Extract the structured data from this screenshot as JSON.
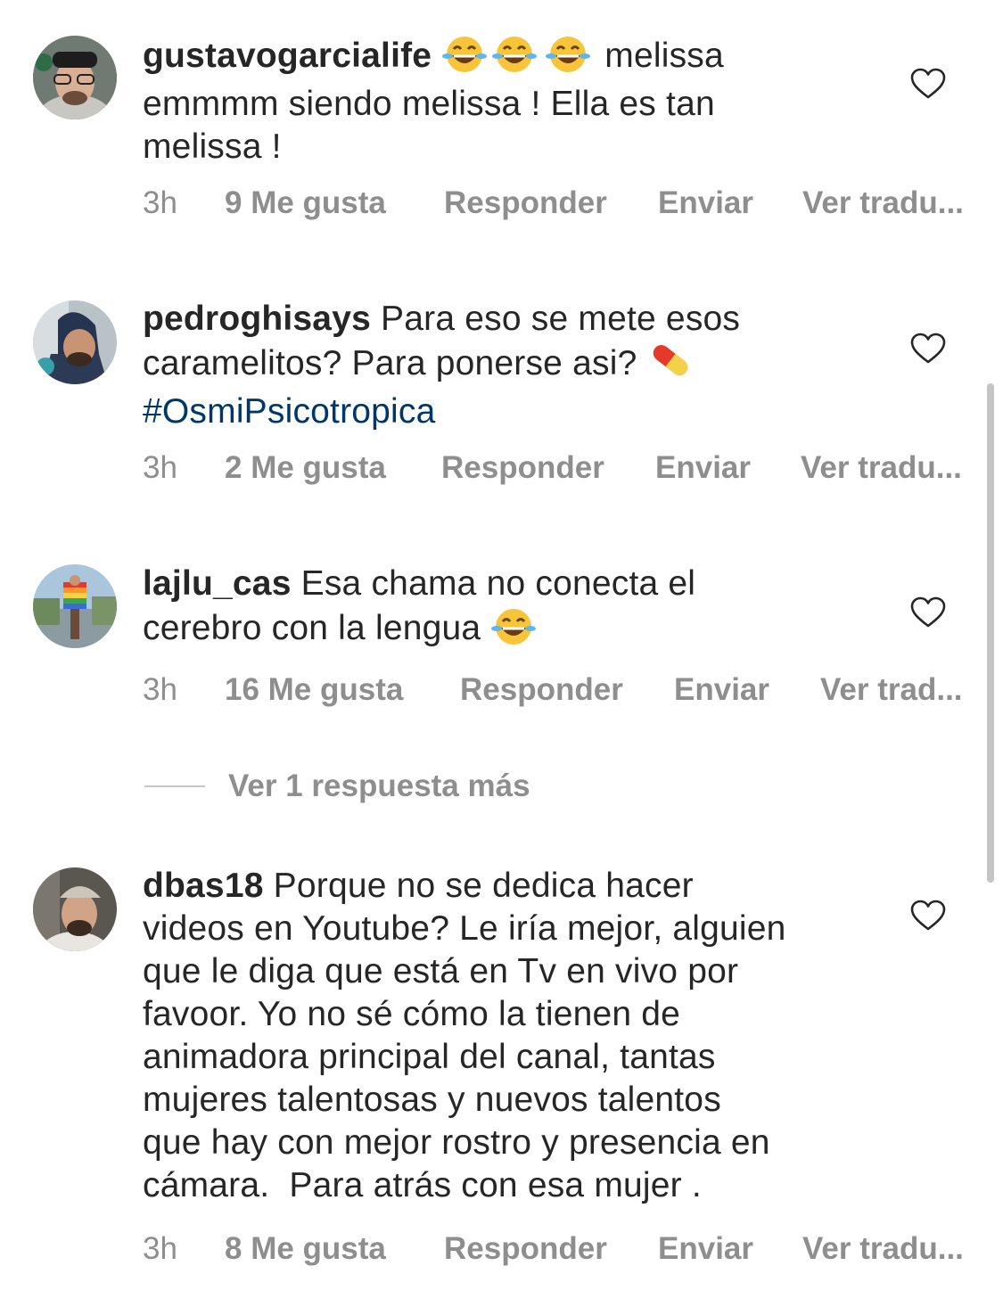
{
  "comments": [
    {
      "username": "gustavogarcialife",
      "text_lines": [
        "melissa",
        "emmmm siendo melissa ! Ella es tan",
        "melissa !"
      ],
      "leading_emoji": [
        "face-with-tears-of-joy",
        "face-with-tears-of-joy",
        "face-with-tears-of-joy"
      ],
      "time": "3h",
      "likes": "9 Me gusta",
      "reply": "Responder",
      "send": "Enviar",
      "translate": "Ver tradu..."
    },
    {
      "username": "pedroghisays",
      "text_line1": "Para eso se mete esos",
      "text_line2": "caramelitos? Para ponerse asi?",
      "trailing_emoji": "pill",
      "hashtag": "#OsmiPsicotropica",
      "time": "3h",
      "likes": "2 Me gusta",
      "reply": "Responder",
      "send": "Enviar",
      "translate": "Ver tradu..."
    },
    {
      "username": "lajlu_cas",
      "text_line1": "Esa chama no conecta el",
      "text_line2": "cerebro con la lengua",
      "trailing_emoji": "face-with-tears-of-joy",
      "time": "3h",
      "likes": "16 Me gusta",
      "reply": "Responder",
      "send": "Enviar",
      "translate": "Ver trad...",
      "more_replies": "Ver 1 respuesta más"
    },
    {
      "username": "dbas18",
      "text_lines": [
        "Porque no se dedica hacer",
        "videos en Youtube? Le iría mejor, alguien",
        "que le diga que está en Tv en vivo por",
        "favoor. Yo no sé cómo la tienen de",
        "animadora principal del canal, tantas",
        "mujeres talentosas y nuevos talentos",
        "que hay con mejor rostro y presencia en",
        "cámara.  Para atrás con esa mujer ."
      ],
      "time": "3h",
      "likes": "8 Me gusta",
      "reply": "Responder",
      "send": "Enviar",
      "translate": "Ver tradu..."
    }
  ],
  "colors": {
    "text": "#262626",
    "secondary": "#8e8e8e",
    "hashtag": "#00376b",
    "divider": "#c7c7c7",
    "scrollbar": "#c4c4c4"
  },
  "icons": {
    "like": "heart-outline-icon"
  }
}
